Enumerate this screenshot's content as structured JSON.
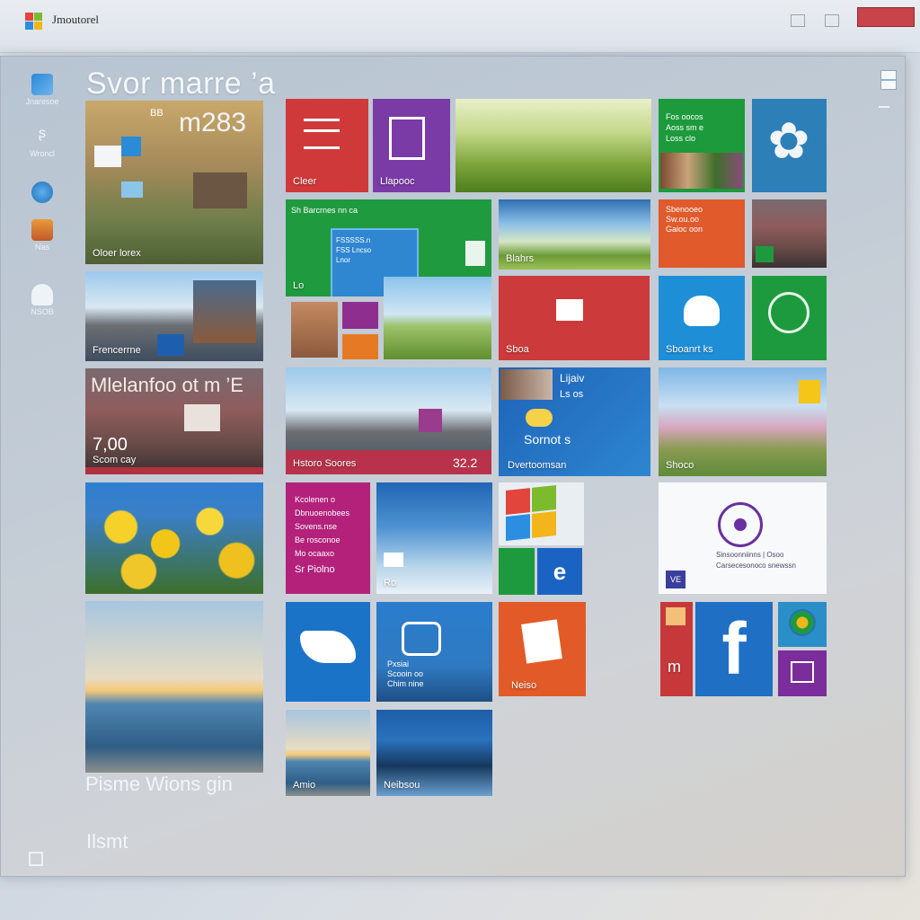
{
  "titlebar": {
    "app_title": "Jmoutorel"
  },
  "screen": {
    "title": "Svor marre ’a",
    "footer_label": "Ilsmt",
    "bottom_caption": "Pisme Wions gin"
  },
  "sidebar": {
    "items": [
      {
        "label": "Jnaresoe",
        "icon": "pen-icon"
      },
      {
        "label": "Wroncl",
        "icon": "user-icon"
      },
      {
        "label": "",
        "icon": "globe-icon"
      },
      {
        "label": "Nas",
        "icon": "folder-icon"
      },
      {
        "label": "NSOB",
        "icon": "cloud-icon"
      }
    ]
  },
  "tiles": {
    "t_collage_1": {
      "label": "Oloer lorex",
      "big": "m283",
      "small": "BB"
    },
    "t_house": {
      "label": "Frencerrne"
    },
    "t_people_red": {
      "headline": "Mlelanfoo ot m ’E",
      "number": "7,00",
      "label": "Scom cay"
    },
    "t_flowers": {},
    "t_sea": {
      "label": "Pisme Wions gin"
    },
    "t_red_list": {
      "label": "Cleer"
    },
    "t_purple_app": {
      "label": "Llapooc"
    },
    "t_grass": {},
    "t_green_news": {
      "lines": [
        "Fos oocos",
        "Aoss sm e",
        "Loss clo"
      ]
    },
    "t_blue_robot": {},
    "t_green_wide": {
      "label": "Lo",
      "lines": [
        "Sh Barcrnes nn ca"
      ],
      "inner_lines": [
        "FSSSSS.n",
        "FSS Lncso",
        "Lnor"
      ]
    },
    "t_lake": {
      "label": "Blahrs"
    },
    "t_orange_text": {
      "lines": [
        "Sbenooeo",
        "Sw.ou.oo",
        "Gaioc oon"
      ]
    },
    "t_small_photos": {},
    "t_person_photo": {},
    "t_small_purple": {},
    "t_small_orange": {},
    "t_tree": {},
    "t_mail": {
      "label": "Sboa"
    },
    "t_weather_blue": {
      "label": "Sboanrt ks"
    },
    "t_green_chart": {},
    "t_city_photo": {},
    "t_people_news": {
      "header": "Lijaiv",
      "sub": "Ls os",
      "main": "Sornot s",
      "label": "Dvertoomsan"
    },
    "t_meadow": {
      "label": "Shoco"
    },
    "t_magenta_news": {
      "lines": [
        "Kcolenen o",
        "Dbnuoenobees",
        "Sovens.nse",
        "Be rosconoe",
        "Mo ocaaxo",
        "Sr Piolno"
      ]
    },
    "t_sky": {
      "label": "Ro"
    },
    "t_windows_logo": {},
    "t_green_small": {},
    "t_ie": {},
    "t_white_cortana": {
      "lines": [
        "Sinsoonniinns | Osoo",
        "Carsecesonoco snewssn"
      ],
      "badge": "VE"
    },
    "t_blue_birds": {},
    "t_store_blue": {
      "lines": [
        "Pxsiai",
        "Scooin oo",
        "Chim nine"
      ]
    },
    "t_office_orange": {
      "label": "Neiso"
    },
    "t_red_m": {
      "label": "m"
    },
    "t_facebook": {
      "label": "f"
    },
    "t_browser_small": {},
    "t_office_purple": {},
    "t_sea_small": {
      "label": "Amio"
    },
    "t_night_small": {
      "label": "Neibsou"
    },
    "t_collage_strip": {
      "label": "Hstoro Soores",
      "num": "32.2"
    }
  }
}
